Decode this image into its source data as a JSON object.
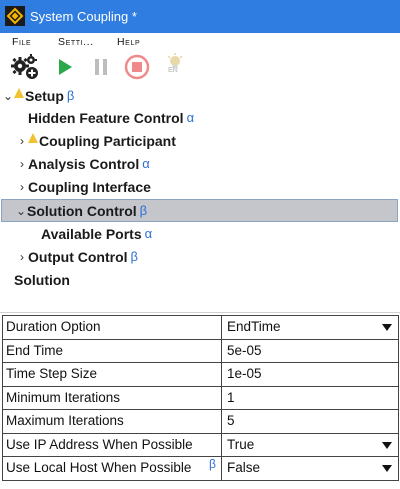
{
  "window": {
    "title": "System Coupling *"
  },
  "menu": {
    "file": "File",
    "settings": "Setti...",
    "help": "Help"
  },
  "toolbar": {
    "en_label": "EN"
  },
  "tree": {
    "setup": {
      "label": "Setup",
      "greek": "β"
    },
    "hidden_feature_control": {
      "label": "Hidden Feature Control",
      "greek": "α"
    },
    "coupling_participant": {
      "label": "Coupling Participant"
    },
    "analysis_control": {
      "label": "Analysis Control",
      "greek": "α"
    },
    "coupling_interface": {
      "label": "Coupling Interface"
    },
    "solution_control": {
      "label": "Solution Control",
      "greek": "β"
    },
    "available_ports": {
      "label": "Available Ports",
      "greek": "α"
    },
    "output_control": {
      "label": "Output Control",
      "greek": "β"
    },
    "solution": {
      "label": "Solution"
    }
  },
  "properties": [
    {
      "name": "Duration Option",
      "value": "EndTime",
      "dropdown": true
    },
    {
      "name": "End Time",
      "value": "5e-05",
      "dropdown": false
    },
    {
      "name": "Time Step Size",
      "value": "1e-05",
      "dropdown": false
    },
    {
      "name": "Minimum Iterations",
      "value": "1",
      "dropdown": false
    },
    {
      "name": "Maximum Iterations",
      "value": "5",
      "dropdown": false
    },
    {
      "name": "Use IP Address When Possible",
      "value": "True",
      "dropdown": true
    },
    {
      "name": "Use Local Host When Possible",
      "value": "False",
      "dropdown": true,
      "greek": "β"
    }
  ],
  "colors": {
    "titlebar": "#2f7de1",
    "play": "#2aa84a",
    "stop": "#f08a8a",
    "greek": "#2b6fd6",
    "warning": "#f2c230"
  }
}
